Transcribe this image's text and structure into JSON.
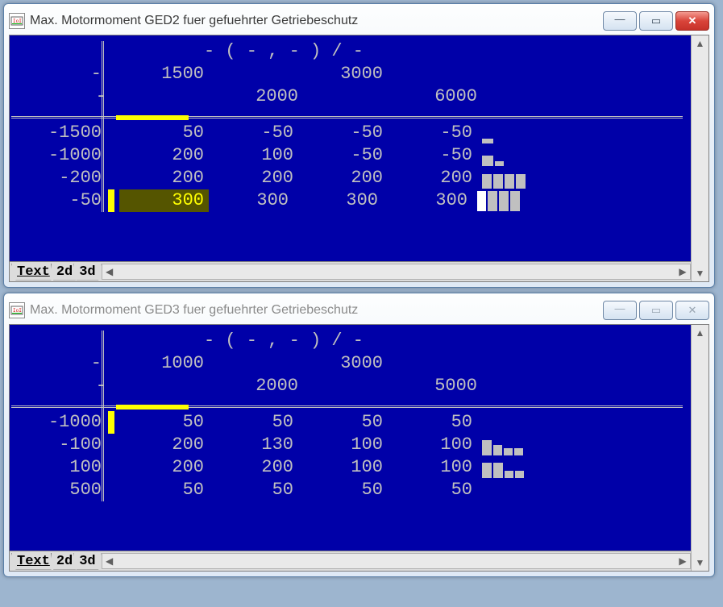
{
  "windows": [
    {
      "id": "ged2",
      "title": "Max. Motormoment GED2 fuer gefuehrter Getriebeschutz",
      "active": true,
      "chart_title": "- ( - , - ) / -",
      "col_axis_a": [
        "1500",
        "",
        "3000",
        ""
      ],
      "col_axis_b": [
        "",
        "2000",
        "",
        "6000"
      ],
      "row_dash": "-",
      "cols_dash": "-",
      "rows_label": [
        "-1500",
        "-1000",
        "-200",
        "-50"
      ],
      "grid": [
        [
          "50",
          "-50",
          "-50",
          "-50"
        ],
        [
          "200",
          "100",
          "-50",
          "-50"
        ],
        [
          "200",
          "200",
          "200",
          "200"
        ],
        [
          "300",
          "300",
          "300",
          "300"
        ]
      ],
      "selected_cell": {
        "row": 3,
        "col": 0
      },
      "yellow_row_marker": 3,
      "spark": [
        [
          [
            14,
            6
          ]
        ],
        [
          [
            14,
            13
          ],
          [
            11,
            6
          ]
        ],
        [
          [
            12,
            18
          ],
          [
            12,
            18
          ],
          [
            12,
            18
          ],
          [
            12,
            18
          ]
        ],
        [
          [
            "white",
            25
          ],
          [
            12,
            25
          ],
          [
            12,
            25
          ],
          [
            12,
            25
          ]
        ]
      ],
      "tabs": [
        "Text",
        "2d",
        "3d"
      ]
    },
    {
      "id": "ged3",
      "title": "Max. Motormoment GED3 fuer gefuehrter Getriebeschutz",
      "active": false,
      "chart_title": "- ( - , - ) / -",
      "col_axis_a": [
        "1000",
        "",
        "3000",
        ""
      ],
      "col_axis_b": [
        "",
        "2000",
        "",
        "5000"
      ],
      "row_dash": "-",
      "cols_dash": "-",
      "rows_label": [
        "-1000",
        "-100",
        "100",
        "500"
      ],
      "grid": [
        [
          "50",
          "50",
          "50",
          "50"
        ],
        [
          "200",
          "130",
          "100",
          "100"
        ],
        [
          "200",
          "200",
          "100",
          "100"
        ],
        [
          "50",
          "50",
          "50",
          "50"
        ]
      ],
      "selected_cell": null,
      "yellow_row_marker": 0,
      "spark": [
        [],
        [
          [
            12,
            19
          ],
          [
            11,
            13
          ],
          [
            11,
            9
          ],
          [
            11,
            9
          ]
        ],
        [
          [
            12,
            19
          ],
          [
            12,
            19
          ],
          [
            11,
            9
          ],
          [
            11,
            9
          ]
        ],
        []
      ],
      "tabs": [
        "Text",
        "2d",
        "3d"
      ]
    }
  ],
  "winbtn_labels": {
    "min": "—",
    "max": "▭",
    "close": "✕"
  },
  "chart_data": [
    {
      "type": "table",
      "title": "Max. Motormoment GED2 fuer gefuehrter Getriebeschutz",
      "x": [
        1500,
        2000,
        3000,
        6000
      ],
      "y": [
        -1500,
        -1000,
        -200,
        -50
      ],
      "values": [
        [
          50,
          -50,
          -50,
          -50
        ],
        [
          200,
          100,
          -50,
          -50
        ],
        [
          200,
          200,
          200,
          200
        ],
        [
          300,
          300,
          300,
          300
        ]
      ]
    },
    {
      "type": "table",
      "title": "Max. Motormoment GED3 fuer gefuehrter Getriebeschutz",
      "x": [
        1000,
        2000,
        3000,
        5000
      ],
      "y": [
        -1000,
        -100,
        100,
        500
      ],
      "values": [
        [
          50,
          50,
          50,
          50
        ],
        [
          200,
          130,
          100,
          100
        ],
        [
          200,
          200,
          100,
          100
        ],
        [
          50,
          50,
          50,
          50
        ]
      ]
    }
  ]
}
